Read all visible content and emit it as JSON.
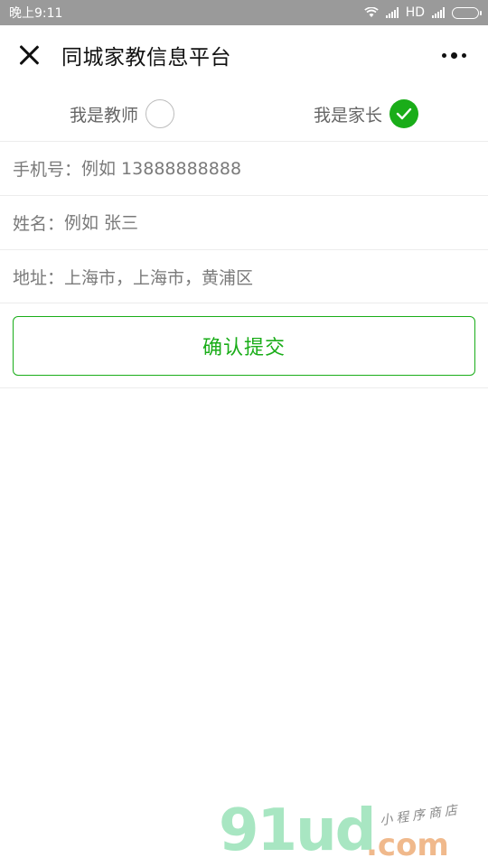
{
  "status_bar": {
    "time": "晚上9:11",
    "network": "HD"
  },
  "header": {
    "title": "同城家教信息平台",
    "close_icon": "close-icon",
    "more_icon": "more-icon"
  },
  "roles": {
    "teacher_label": "我是教师",
    "parent_label": "我是家长",
    "selected": "parent"
  },
  "form": {
    "phone_label": "手机号：",
    "phone_placeholder": "例如 13888888888",
    "name_label": "姓名：",
    "name_placeholder": "例如 张三",
    "address_label": "地址：",
    "address_value": "上海市，上海市，黄浦区"
  },
  "submit_label": "确认提交",
  "watermark": {
    "logo": "91ud",
    "dotcom": ".com",
    "tagline": "小程序商店"
  },
  "colors": {
    "accent": "#1aad19",
    "status_bar": "#9a9a9a"
  }
}
